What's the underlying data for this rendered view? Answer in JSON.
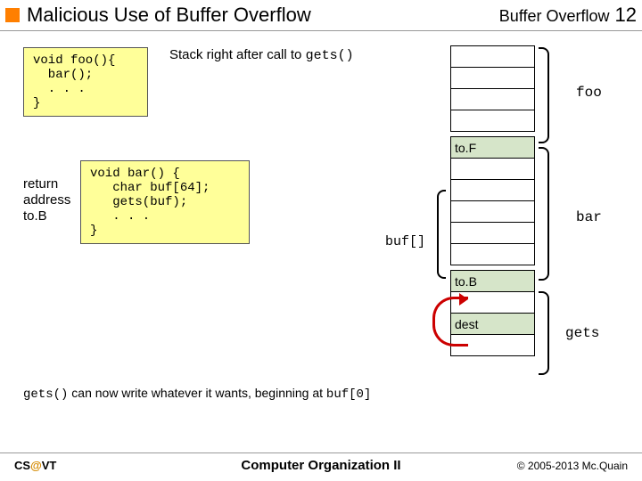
{
  "header": {
    "title": "Malicious Use of Buffer Overflow",
    "section": "Buffer Overflow",
    "page": "12"
  },
  "code": {
    "foo": "void foo(){\n  bar();\n  . . .\n}",
    "bar": "void bar() {\n   char buf[64];\n   gets(buf);\n   . . .\n}"
  },
  "captions": {
    "stack_after": "Stack right after call to ",
    "stack_after_fn": "gets()",
    "return_addr": "return\naddress\nto.B",
    "buf_label": "buf[]"
  },
  "stack": {
    "toF": "to.F",
    "toB": "to.B",
    "dest": "dest"
  },
  "braces": {
    "foo": "foo",
    "bar": "bar",
    "gets": "gets"
  },
  "explain": {
    "pre": "gets()",
    "mid": " can now write whatever it wants, beginning at ",
    "post": "buf[0]"
  },
  "footer": {
    "left_pre": "CS",
    "left_at": "@",
    "left_post": "VT",
    "center": "Computer Organization II",
    "right": "© 2005-2013 Mc.Quain"
  }
}
